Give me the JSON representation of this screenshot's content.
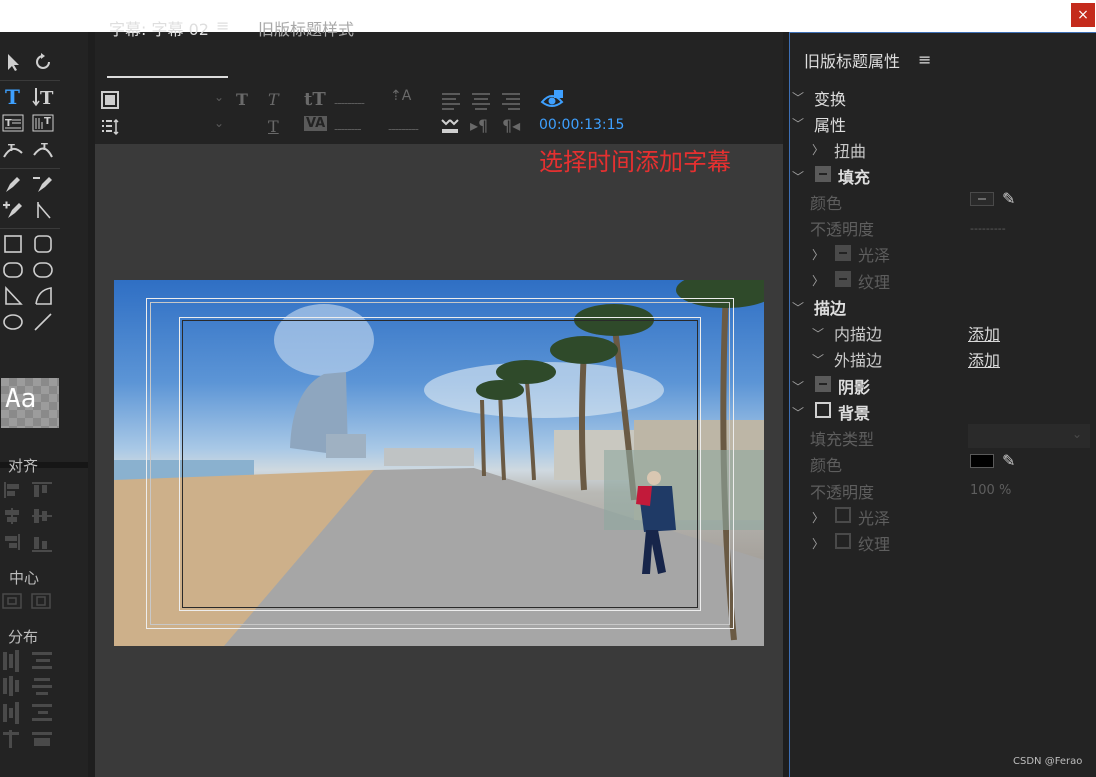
{
  "window": {
    "close_label": "×"
  },
  "center": {
    "tab_active": "字幕: 字幕 02",
    "tab_menu_glyph": "≡",
    "tab_inactive": "旧版标题样式",
    "timecode": "00:00:13:15",
    "annotation": "选择时间添加字幕",
    "dashes_short": "---------",
    "dashes_mid": "--------",
    "dashes_long": "---------"
  },
  "tools": {
    "aa_label": "Aa",
    "align_label": "对齐",
    "center_label": "中心",
    "distribute_label": "分布"
  },
  "properties": {
    "title": "旧版标题属性",
    "menu_glyph": "≡",
    "transform": "变换",
    "attributes": "属性",
    "distort": "扭曲",
    "fill": "填充",
    "color": "颜色",
    "opacity": "不透明度",
    "opacity_value": "---------",
    "sheen": "光泽",
    "texture": "纹理",
    "strokes": "描边",
    "inner_stroke": "内描边",
    "outer_stroke": "外描边",
    "add": "添加",
    "shadow": "阴影",
    "background": "背景",
    "fill_type": "填充类型",
    "bg_color": "颜色",
    "bg_opacity": "不透明度",
    "bg_opacity_value": "100 %",
    "bg_sheen": "光泽",
    "bg_texture": "纹理"
  },
  "colors": {
    "accent": "#3ea0ff",
    "annotation": "#e53030",
    "panel": "#232323",
    "canvas": "#3a3a3a"
  },
  "watermark": "CSDN @Ferao"
}
